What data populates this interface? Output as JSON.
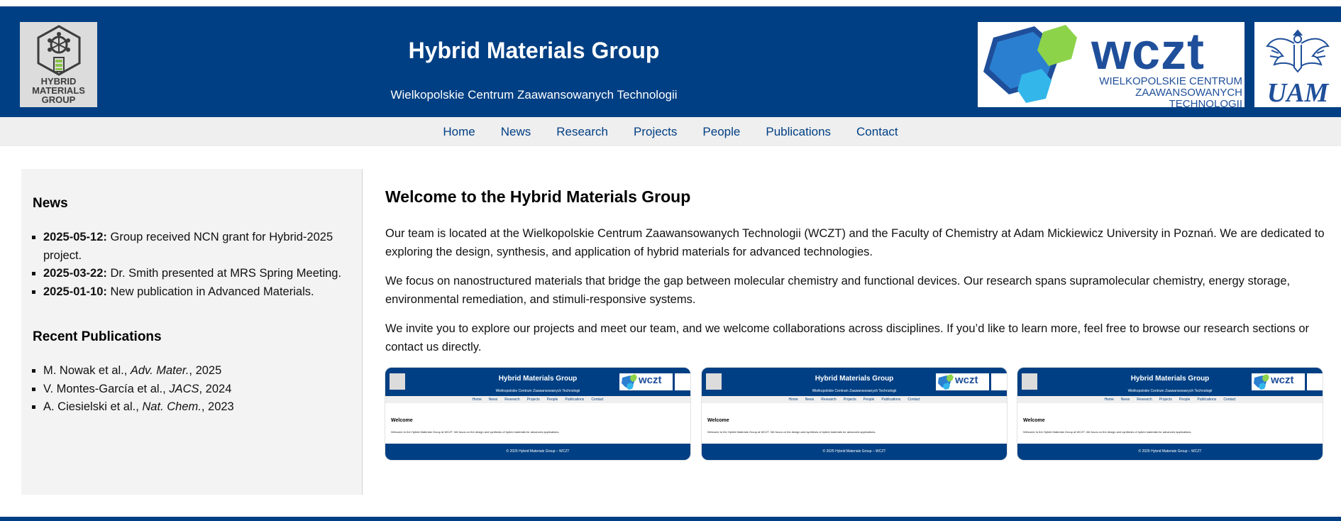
{
  "header": {
    "title": "Hybrid Materials Group",
    "subtitle": "Wielkopolskie Centrum Zaawansowanych Technologii",
    "logo_left_lines": [
      "HYBRID",
      "MATERIALS",
      "GROUP"
    ],
    "wczt_word": "wczt",
    "wczt_sub_lines": [
      "WIELKOPOLSKIE CENTRUM",
      "ZAAWANSOWANYCH TECHNOLOGII"
    ],
    "uam_text": "UAM"
  },
  "nav": [
    "Home",
    "News",
    "Research",
    "Projects",
    "People",
    "Publications",
    "Contact"
  ],
  "sidebar": {
    "news_heading": "News",
    "news": [
      {
        "date": "2025-05-12:",
        "text": " Group received NCN grant for Hybrid-2025 project."
      },
      {
        "date": "2025-03-22:",
        "text": " Dr. Smith presented at MRS Spring Meeting."
      },
      {
        "date": "2025-01-10:",
        "text": " New publication in Advanced Materials."
      }
    ],
    "pubs_heading": "Recent Publications",
    "pubs": [
      {
        "authors": "M. Nowak et al., ",
        "journal": "Adv. Mater.",
        "year": ", 2025"
      },
      {
        "authors": "V. Montes-García et al., ",
        "journal": "JACS",
        "year": ", 2024"
      },
      {
        "authors": "A. Ciesielski et al., ",
        "journal": "Nat. Chem.",
        "year": ", 2023"
      }
    ]
  },
  "main": {
    "heading": "Welcome to the Hybrid Materials Group",
    "p1": "Our team is located at the Wielkopolskie Centrum Zaawansowanych Technologii (WCZT) and the Faculty of Chemistry at Adam Mickiewicz University in Poznań. We are dedicated to exploring the design, synthesis, and application of hybrid materials for advanced technologies.",
    "p2": "We focus on nanostructured materials that bridge the gap between molecular chemistry and functional devices. Our research spans supramolecular chemistry, energy storage, environmental remediation, and stimuli-responsive systems.",
    "p3": "We invite you to explore our projects and meet our team, and we welcome collaborations across disciplines. If you’d like to learn more, feel free to browse our research sections or contact us directly."
  },
  "thumbnail": {
    "title": "Hybrid Materials Group",
    "subtitle": "Wielkopolskie Centrum Zaawansowanych Technologii",
    "nav": [
      "Home",
      "News",
      "Research",
      "Projects",
      "People",
      "Publications",
      "Contact"
    ],
    "heading": "Welcome",
    "text": "Welcome to the Hybrid Materials Group at WCZT. We focus on the design and synthesis of hybrid materials for advanced applications.",
    "footer": "© 2025 Hybrid Materials Group – WCZT",
    "wczt_word": "wczt"
  },
  "colors": {
    "brand_blue": "#003f83",
    "nav_bg": "#efefef",
    "sidebar_bg": "#f3f3f3",
    "logo_gray": "#dcdcdc",
    "logo_green": "#8bc34a"
  }
}
